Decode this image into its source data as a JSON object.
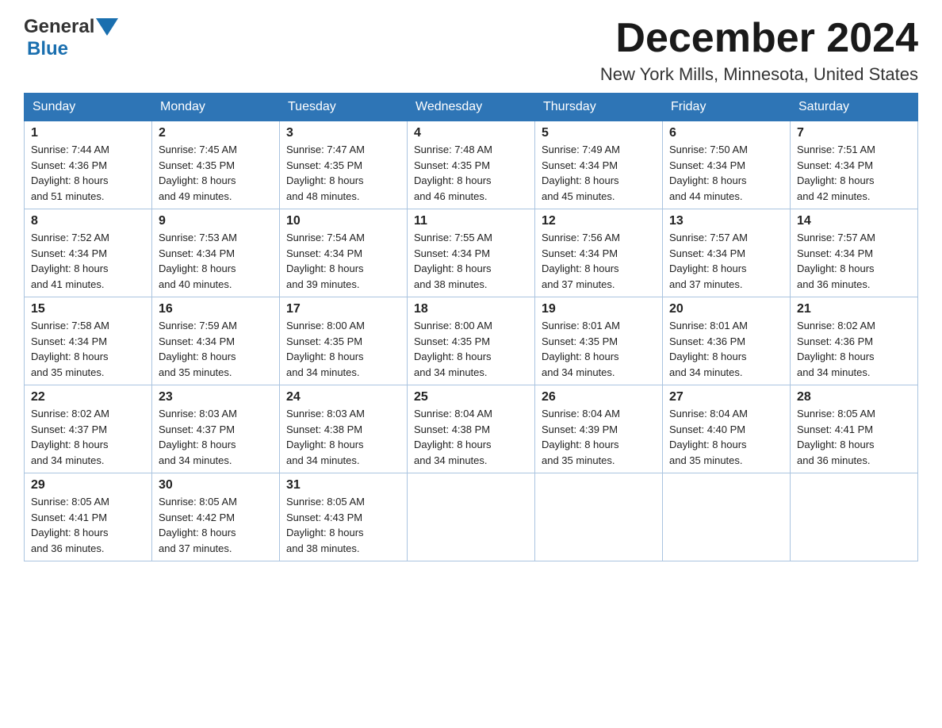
{
  "header": {
    "logo_general": "General",
    "logo_blue": "Blue",
    "month_title": "December 2024",
    "location": "New York Mills, Minnesota, United States"
  },
  "days_of_week": [
    "Sunday",
    "Monday",
    "Tuesday",
    "Wednesday",
    "Thursday",
    "Friday",
    "Saturday"
  ],
  "weeks": [
    [
      {
        "day": "1",
        "sunrise": "7:44 AM",
        "sunset": "4:36 PM",
        "daylight": "8 hours and 51 minutes."
      },
      {
        "day": "2",
        "sunrise": "7:45 AM",
        "sunset": "4:35 PM",
        "daylight": "8 hours and 49 minutes."
      },
      {
        "day": "3",
        "sunrise": "7:47 AM",
        "sunset": "4:35 PM",
        "daylight": "8 hours and 48 minutes."
      },
      {
        "day": "4",
        "sunrise": "7:48 AM",
        "sunset": "4:35 PM",
        "daylight": "8 hours and 46 minutes."
      },
      {
        "day": "5",
        "sunrise": "7:49 AM",
        "sunset": "4:34 PM",
        "daylight": "8 hours and 45 minutes."
      },
      {
        "day": "6",
        "sunrise": "7:50 AM",
        "sunset": "4:34 PM",
        "daylight": "8 hours and 44 minutes."
      },
      {
        "day": "7",
        "sunrise": "7:51 AM",
        "sunset": "4:34 PM",
        "daylight": "8 hours and 42 minutes."
      }
    ],
    [
      {
        "day": "8",
        "sunrise": "7:52 AM",
        "sunset": "4:34 PM",
        "daylight": "8 hours and 41 minutes."
      },
      {
        "day": "9",
        "sunrise": "7:53 AM",
        "sunset": "4:34 PM",
        "daylight": "8 hours and 40 minutes."
      },
      {
        "day": "10",
        "sunrise": "7:54 AM",
        "sunset": "4:34 PM",
        "daylight": "8 hours and 39 minutes."
      },
      {
        "day": "11",
        "sunrise": "7:55 AM",
        "sunset": "4:34 PM",
        "daylight": "8 hours and 38 minutes."
      },
      {
        "day": "12",
        "sunrise": "7:56 AM",
        "sunset": "4:34 PM",
        "daylight": "8 hours and 37 minutes."
      },
      {
        "day": "13",
        "sunrise": "7:57 AM",
        "sunset": "4:34 PM",
        "daylight": "8 hours and 37 minutes."
      },
      {
        "day": "14",
        "sunrise": "7:57 AM",
        "sunset": "4:34 PM",
        "daylight": "8 hours and 36 minutes."
      }
    ],
    [
      {
        "day": "15",
        "sunrise": "7:58 AM",
        "sunset": "4:34 PM",
        "daylight": "8 hours and 35 minutes."
      },
      {
        "day": "16",
        "sunrise": "7:59 AM",
        "sunset": "4:34 PM",
        "daylight": "8 hours and 35 minutes."
      },
      {
        "day": "17",
        "sunrise": "8:00 AM",
        "sunset": "4:35 PM",
        "daylight": "8 hours and 34 minutes."
      },
      {
        "day": "18",
        "sunrise": "8:00 AM",
        "sunset": "4:35 PM",
        "daylight": "8 hours and 34 minutes."
      },
      {
        "day": "19",
        "sunrise": "8:01 AM",
        "sunset": "4:35 PM",
        "daylight": "8 hours and 34 minutes."
      },
      {
        "day": "20",
        "sunrise": "8:01 AM",
        "sunset": "4:36 PM",
        "daylight": "8 hours and 34 minutes."
      },
      {
        "day": "21",
        "sunrise": "8:02 AM",
        "sunset": "4:36 PM",
        "daylight": "8 hours and 34 minutes."
      }
    ],
    [
      {
        "day": "22",
        "sunrise": "8:02 AM",
        "sunset": "4:37 PM",
        "daylight": "8 hours and 34 minutes."
      },
      {
        "day": "23",
        "sunrise": "8:03 AM",
        "sunset": "4:37 PM",
        "daylight": "8 hours and 34 minutes."
      },
      {
        "day": "24",
        "sunrise": "8:03 AM",
        "sunset": "4:38 PM",
        "daylight": "8 hours and 34 minutes."
      },
      {
        "day": "25",
        "sunrise": "8:04 AM",
        "sunset": "4:38 PM",
        "daylight": "8 hours and 34 minutes."
      },
      {
        "day": "26",
        "sunrise": "8:04 AM",
        "sunset": "4:39 PM",
        "daylight": "8 hours and 35 minutes."
      },
      {
        "day": "27",
        "sunrise": "8:04 AM",
        "sunset": "4:40 PM",
        "daylight": "8 hours and 35 minutes."
      },
      {
        "day": "28",
        "sunrise": "8:05 AM",
        "sunset": "4:41 PM",
        "daylight": "8 hours and 36 minutes."
      }
    ],
    [
      {
        "day": "29",
        "sunrise": "8:05 AM",
        "sunset": "4:41 PM",
        "daylight": "8 hours and 36 minutes."
      },
      {
        "day": "30",
        "sunrise": "8:05 AM",
        "sunset": "4:42 PM",
        "daylight": "8 hours and 37 minutes."
      },
      {
        "day": "31",
        "sunrise": "8:05 AM",
        "sunset": "4:43 PM",
        "daylight": "8 hours and 38 minutes."
      },
      null,
      null,
      null,
      null
    ]
  ],
  "labels": {
    "sunrise": "Sunrise:",
    "sunset": "Sunset:",
    "daylight": "Daylight:"
  }
}
